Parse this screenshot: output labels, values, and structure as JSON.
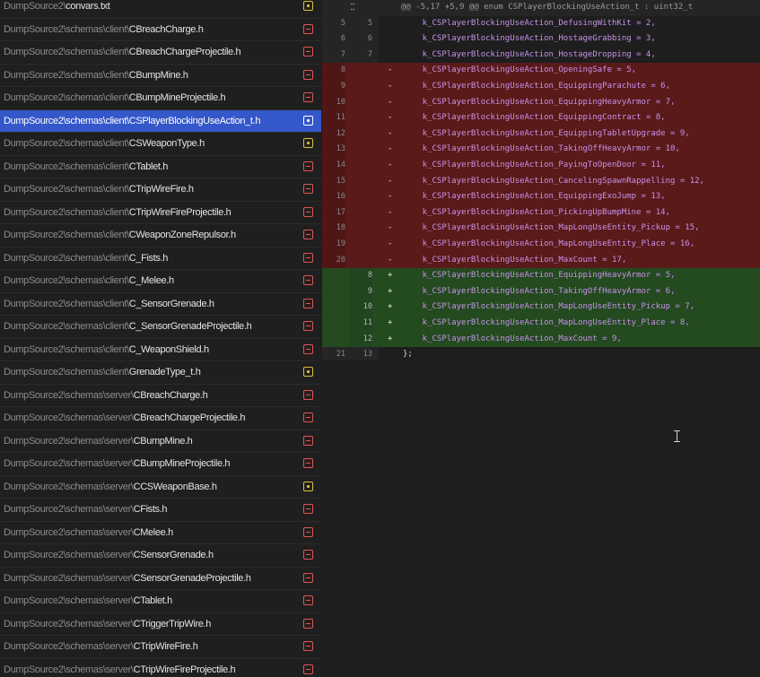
{
  "files": [
    {
      "dir": "DumpSource2\\",
      "name": "convars.txt",
      "status": "modified",
      "selected": false
    },
    {
      "dir": "DumpSource2\\schemas\\client\\",
      "name": "CBreachCharge.h",
      "status": "deleted",
      "selected": false
    },
    {
      "dir": "DumpSource2\\schemas\\client\\",
      "name": "CBreachChargeProjectile.h",
      "status": "deleted",
      "selected": false
    },
    {
      "dir": "DumpSource2\\schemas\\client\\",
      "name": "CBumpMine.h",
      "status": "deleted",
      "selected": false
    },
    {
      "dir": "DumpSource2\\schemas\\client\\",
      "name": "CBumpMineProjectile.h",
      "status": "deleted",
      "selected": false
    },
    {
      "dir": "DumpSource2\\schemas\\client\\",
      "name": "CSPlayerBlockingUseAction_t.h",
      "status": "modified",
      "selected": true
    },
    {
      "dir": "DumpSource2\\schemas\\client\\",
      "name": "CSWeaponType.h",
      "status": "modified",
      "selected": false
    },
    {
      "dir": "DumpSource2\\schemas\\client\\",
      "name": "CTablet.h",
      "status": "deleted",
      "selected": false
    },
    {
      "dir": "DumpSource2\\schemas\\client\\",
      "name": "CTripWireFire.h",
      "status": "deleted",
      "selected": false
    },
    {
      "dir": "DumpSource2\\schemas\\client\\",
      "name": "CTripWireFireProjectile.h",
      "status": "deleted",
      "selected": false
    },
    {
      "dir": "DumpSource2\\schemas\\client\\",
      "name": "CWeaponZoneRepulsor.h",
      "status": "deleted",
      "selected": false
    },
    {
      "dir": "DumpSource2\\schemas\\client\\",
      "name": "C_Fists.h",
      "status": "deleted",
      "selected": false
    },
    {
      "dir": "DumpSource2\\schemas\\client\\",
      "name": "C_Melee.h",
      "status": "deleted",
      "selected": false
    },
    {
      "dir": "DumpSource2\\schemas\\client\\",
      "name": "C_SensorGrenade.h",
      "status": "deleted",
      "selected": false
    },
    {
      "dir": "DumpSource2\\schemas\\client\\",
      "name": "C_SensorGrenadeProjectile.h",
      "status": "deleted",
      "selected": false
    },
    {
      "dir": "DumpSource2\\schemas\\client\\",
      "name": "C_WeaponShield.h",
      "status": "deleted",
      "selected": false
    },
    {
      "dir": "DumpSource2\\schemas\\client\\",
      "name": "GrenadeType_t.h",
      "status": "modified",
      "selected": false
    },
    {
      "dir": "DumpSource2\\schemas\\server\\",
      "name": "CBreachCharge.h",
      "status": "deleted",
      "selected": false
    },
    {
      "dir": "DumpSource2\\schemas\\server\\",
      "name": "CBreachChargeProjectile.h",
      "status": "deleted",
      "selected": false
    },
    {
      "dir": "DumpSource2\\schemas\\server\\",
      "name": "CBumpMine.h",
      "status": "deleted",
      "selected": false
    },
    {
      "dir": "DumpSource2\\schemas\\server\\",
      "name": "CBumpMineProjectile.h",
      "status": "deleted",
      "selected": false
    },
    {
      "dir": "DumpSource2\\schemas\\server\\",
      "name": "CCSWeaponBase.h",
      "status": "modified",
      "selected": false
    },
    {
      "dir": "DumpSource2\\schemas\\server\\",
      "name": "CFists.h",
      "status": "deleted",
      "selected": false
    },
    {
      "dir": "DumpSource2\\schemas\\server\\",
      "name": "CMelee.h",
      "status": "deleted",
      "selected": false
    },
    {
      "dir": "DumpSource2\\schemas\\server\\",
      "name": "CSensorGrenade.h",
      "status": "deleted",
      "selected": false
    },
    {
      "dir": "DumpSource2\\schemas\\server\\",
      "name": "CSensorGrenadeProjectile.h",
      "status": "deleted",
      "selected": false
    },
    {
      "dir": "DumpSource2\\schemas\\server\\",
      "name": "CTablet.h",
      "status": "deleted",
      "selected": false
    },
    {
      "dir": "DumpSource2\\schemas\\server\\",
      "name": "CTriggerTripWire.h",
      "status": "deleted",
      "selected": false
    },
    {
      "dir": "DumpSource2\\schemas\\server\\",
      "name": "CTripWireFire.h",
      "status": "deleted",
      "selected": false
    },
    {
      "dir": "DumpSource2\\schemas\\server\\",
      "name": "CTripWireFireProjectile.h",
      "status": "deleted",
      "selected": false
    }
  ],
  "diff": {
    "hunk_header": "@@ -5,17 +5,9 @@ enum CSPlayerBlockingUseAction_t : uint32_t",
    "lines": [
      {
        "type": "context",
        "old": "5",
        "new": "5",
        "marker": "",
        "code": "    k_CSPlayerBlockingUseAction_DefusingWithKit = 2,"
      },
      {
        "type": "context",
        "old": "6",
        "new": "6",
        "marker": "",
        "code": "    k_CSPlayerBlockingUseAction_HostageGrabbing = 3,"
      },
      {
        "type": "context",
        "old": "7",
        "new": "7",
        "marker": "",
        "code": "    k_CSPlayerBlockingUseAction_HostageDropping = 4,"
      },
      {
        "type": "removed",
        "old": "8",
        "new": "",
        "marker": "-",
        "code": "    k_CSPlayerBlockingUseAction_OpeningSafe = 5,"
      },
      {
        "type": "removed",
        "old": "9",
        "new": "",
        "marker": "-",
        "code": "    k_CSPlayerBlockingUseAction_EquippingParachute = 6,"
      },
      {
        "type": "removed",
        "old": "10",
        "new": "",
        "marker": "-",
        "code": "    k_CSPlayerBlockingUseAction_EquippingHeavyArmor = 7,"
      },
      {
        "type": "removed",
        "old": "11",
        "new": "",
        "marker": "-",
        "code": "    k_CSPlayerBlockingUseAction_EquippingContract = 8,"
      },
      {
        "type": "removed",
        "old": "12",
        "new": "",
        "marker": "-",
        "code": "    k_CSPlayerBlockingUseAction_EquippingTabletUpgrade = 9,"
      },
      {
        "type": "removed",
        "old": "13",
        "new": "",
        "marker": "-",
        "code": "    k_CSPlayerBlockingUseAction_TakingOffHeavyArmor = 10,"
      },
      {
        "type": "removed",
        "old": "14",
        "new": "",
        "marker": "-",
        "code": "    k_CSPlayerBlockingUseAction_PayingToOpenDoor = 11,"
      },
      {
        "type": "removed",
        "old": "15",
        "new": "",
        "marker": "-",
        "code": "    k_CSPlayerBlockingUseAction_CancelingSpawnRappelling = 12,"
      },
      {
        "type": "removed",
        "old": "16",
        "new": "",
        "marker": "-",
        "code": "    k_CSPlayerBlockingUseAction_EquippingExoJump = 13,"
      },
      {
        "type": "removed",
        "old": "17",
        "new": "",
        "marker": "-",
        "code": "    k_CSPlayerBlockingUseAction_PickingUpBumpMine = 14,"
      },
      {
        "type": "removed",
        "old": "18",
        "new": "",
        "marker": "-",
        "code": "    k_CSPlayerBlockingUseAction_MapLongUseEntity_Pickup = 15,"
      },
      {
        "type": "removed",
        "old": "19",
        "new": "",
        "marker": "-",
        "code": "    k_CSPlayerBlockingUseAction_MapLongUseEntity_Place = 16,"
      },
      {
        "type": "removed",
        "old": "20",
        "new": "",
        "marker": "-",
        "code": "    k_CSPlayerBlockingUseAction_MaxCount = 17,"
      },
      {
        "type": "added",
        "old": "",
        "new": "8",
        "marker": "+",
        "code": "    k_CSPlayerBlockingUseAction_EquippingHeavyArmor = 5,"
      },
      {
        "type": "added",
        "old": "",
        "new": "9",
        "marker": "+",
        "code": "    k_CSPlayerBlockingUseAction_TakingOffHeavyArmor = 6,"
      },
      {
        "type": "added",
        "old": "",
        "new": "10",
        "marker": "+",
        "code": "    k_CSPlayerBlockingUseAction_MapLongUseEntity_Pickup = 7,"
      },
      {
        "type": "added",
        "old": "",
        "new": "11",
        "marker": "+",
        "code": "    k_CSPlayerBlockingUseAction_MapLongUseEntity_Place = 8,"
      },
      {
        "type": "added",
        "old": "",
        "new": "12",
        "marker": "+",
        "code": "    k_CSPlayerBlockingUseAction_MaxCount = 9,"
      },
      {
        "type": "closing",
        "old": "21",
        "new": "13",
        "marker": "",
        "code": "};"
      }
    ]
  },
  "colors": {
    "selected_row": "#3457c9",
    "deleted_status": "#e05555",
    "modified_status": "#d7c23c",
    "removed_bg": "#5a1a1a",
    "added_bg": "#244a1f",
    "identifier": "#c792ea"
  },
  "icons": {
    "expand": "expand-hunk-icon",
    "deleted": "file-deleted-icon",
    "modified": "file-modified-icon",
    "cursor": "text-cursor-icon"
  }
}
